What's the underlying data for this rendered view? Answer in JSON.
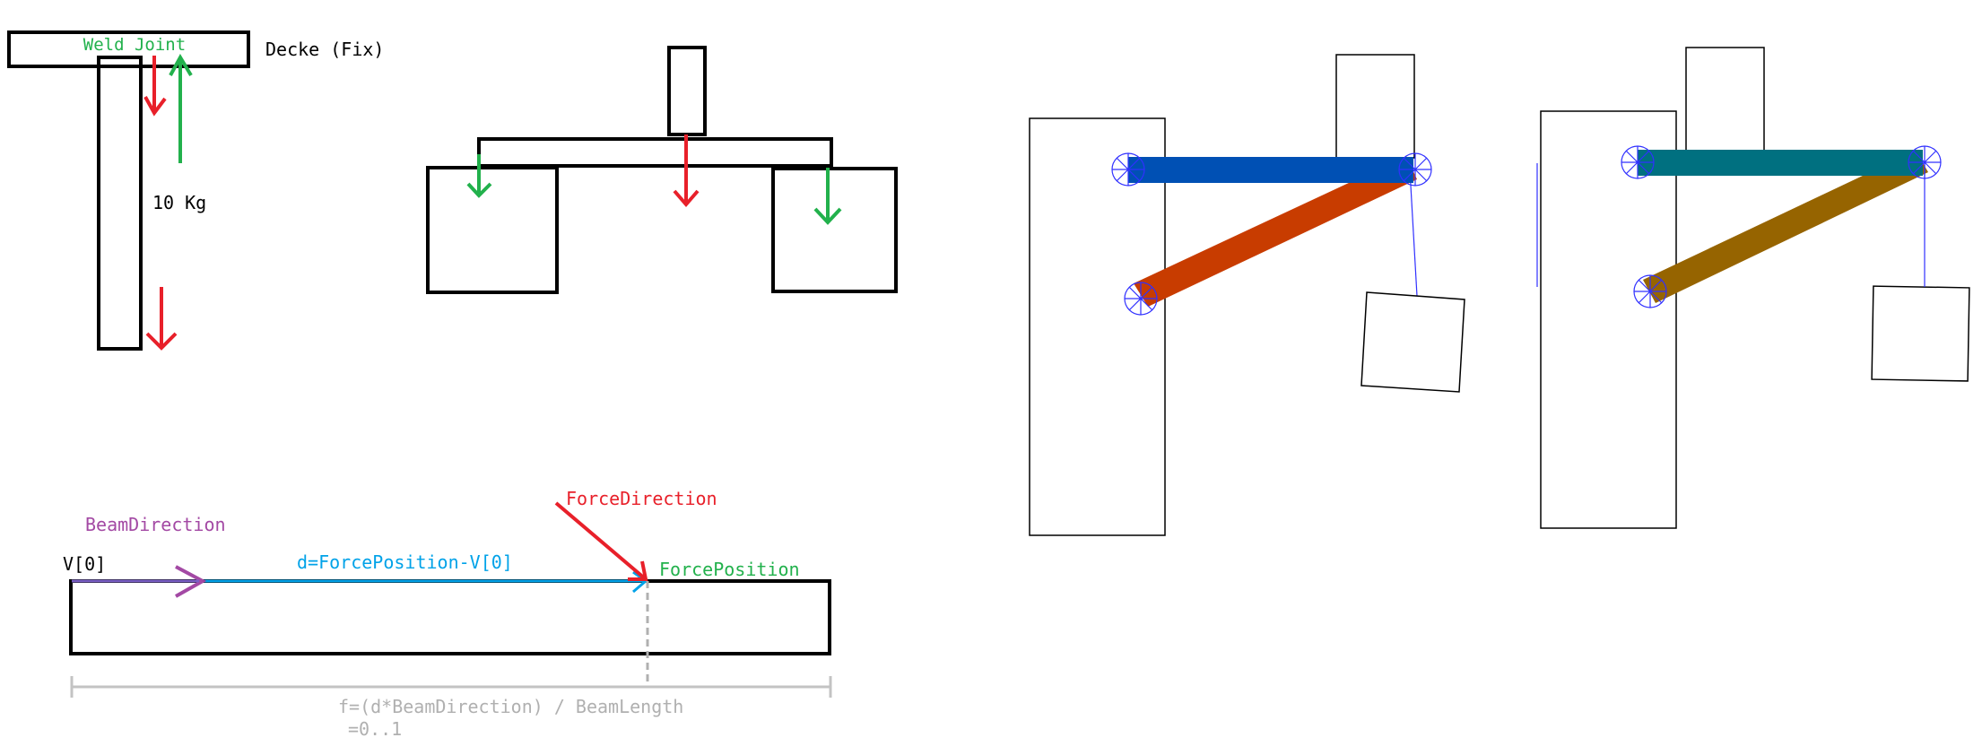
{
  "labels": {
    "weld_joint": "Weld Joint",
    "ceiling": "Decke (Fix)",
    "mass": "10 Kg",
    "beam_direction": "BeamDirection",
    "force_direction": "ForceDirection",
    "v0": "V[0]",
    "d_formula": "d=ForcePosition-V[0]",
    "force_position": "ForcePosition",
    "f_formula": "f=(d*BeamDirection) / BeamLength",
    "f_range": "=0..1"
  },
  "colors": {
    "red": "#e8202a",
    "green": "#22b14c",
    "purple": "#a349a4",
    "cyan": "#00a2e8",
    "gray": "#c3c3c3",
    "blue_beam": "#0050b4",
    "orange_beam": "#c83c00",
    "teal_beam": "#007080",
    "brown_beam": "#966400",
    "joint_blue": "#3030ff"
  }
}
